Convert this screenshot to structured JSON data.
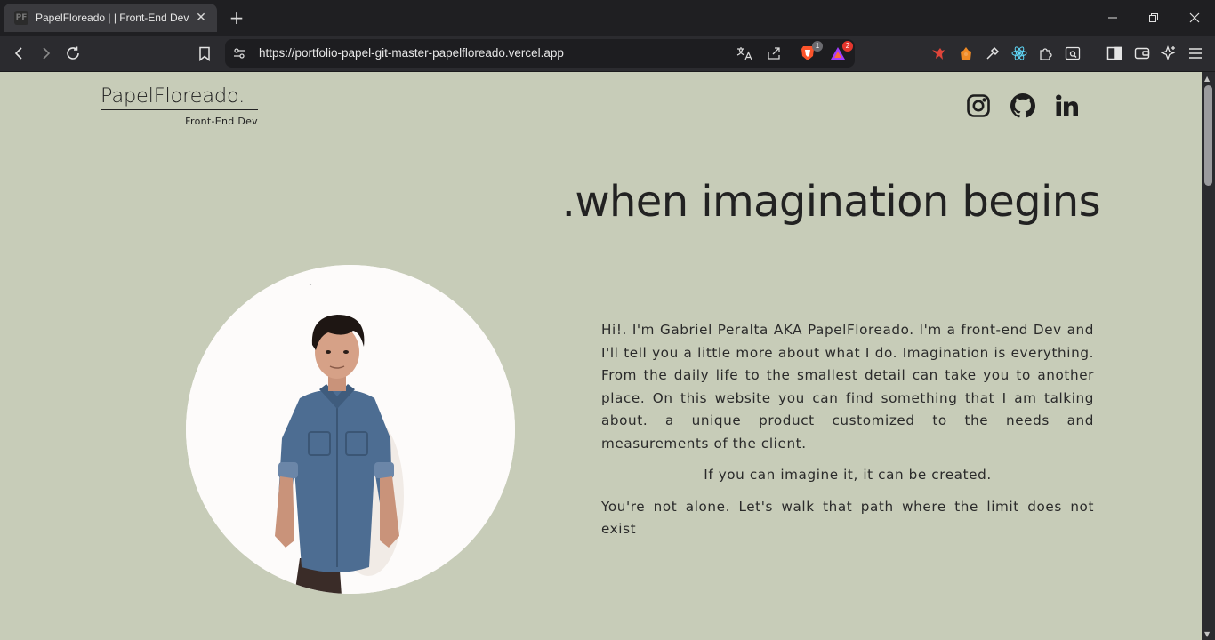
{
  "browser": {
    "tab": {
      "title": "PapelFloreado | | Front-End Dev",
      "favicon": "PF"
    },
    "url": "https://portfolio-papel-git-master-papelfloreado.vercel.app",
    "brave_shield_count": "1",
    "rewards_count": "2",
    "icons": [
      "back-icon",
      "forward-icon",
      "reload-icon",
      "bookmark-icon",
      "site-settings-icon",
      "translate-icon",
      "share-icon",
      "brave-shield-icon",
      "brave-rewards-icon",
      "extension-icons",
      "extensions-puzzle-icon",
      "tab-search-icon",
      "sidebar-icon",
      "wallet-icon",
      "leo-ai-icon",
      "menu-icon"
    ]
  },
  "site": {
    "logo": {
      "name": "PapelFloreado.",
      "subtitle": "Front-End Dev"
    },
    "social": [
      "instagram-icon",
      "github-icon",
      "linkedin-icon"
    ],
    "headline": ".when imagination begins",
    "bio": {
      "intro": "Hi!. I'm Gabriel Peralta AKA PapelFloreado. I'm a front-end Dev and I'll tell you a little more about what I do. Imagination is everything. From the daily life to the smallest detail can take you to another place. On this website you can find something that I am talking about. a unique product customized to the needs and measurements of the client.",
      "tagline": "If you can imagine it, it can be created.",
      "closing": "You're not alone. Let's walk that path where the limit does not exist"
    }
  },
  "colors": {
    "page_bg": "#c7ccb8",
    "text": "#222222",
    "browser_chrome": "#2b2b2f"
  }
}
